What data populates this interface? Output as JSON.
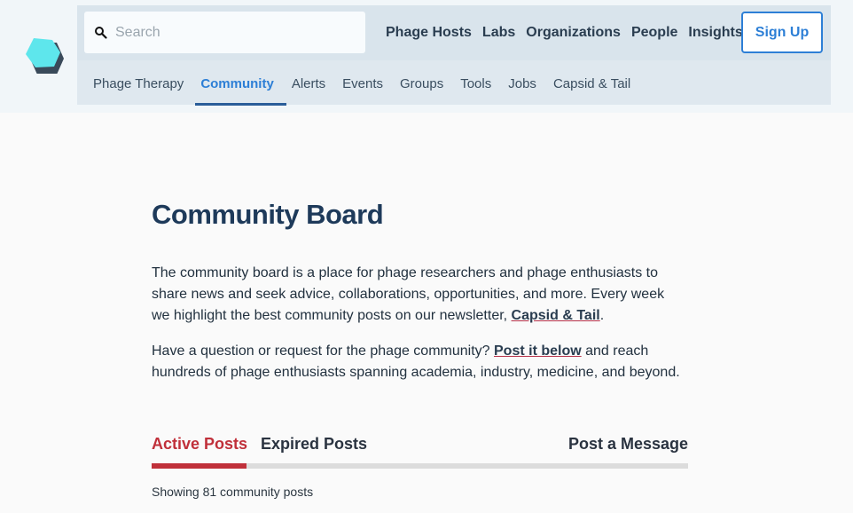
{
  "search": {
    "placeholder": "Search"
  },
  "topnav": [
    {
      "label": "Phage Hosts"
    },
    {
      "label": "Labs"
    },
    {
      "label": "Organizations"
    },
    {
      "label": "People"
    },
    {
      "label": "Insights"
    }
  ],
  "signup_label": "Sign Up",
  "subnav": [
    {
      "label": "Phage Therapy"
    },
    {
      "label": "Community"
    },
    {
      "label": "Alerts"
    },
    {
      "label": "Events"
    },
    {
      "label": "Groups"
    },
    {
      "label": "Tools"
    },
    {
      "label": "Jobs"
    },
    {
      "label": "Capsid & Tail"
    }
  ],
  "page": {
    "title": "Community Board",
    "intro_pre": "The community board is a place for phage researchers and phage enthusiasts to share news and seek advice, collaborations, opportunities, and more. Every week we highlight the best community posts on our newsletter, ",
    "intro_link": "Capsid & Tail",
    "intro_post": ".",
    "q_pre": "Have a question or request for the phage community? ",
    "q_link": "Post it below",
    "q_post": " and reach hundreds of phage enthusiasts spanning academia, industry, medicine, and beyond."
  },
  "tabs": {
    "active": "Active Posts",
    "expired": "Expired Posts",
    "post": "Post a Message"
  },
  "status": {
    "count_text": "Showing 81 community posts"
  },
  "colors": {
    "accent": "#2d7fd6",
    "brand_red": "#c0303a",
    "heading": "#1e3a5a",
    "logo": "#5ee6ec"
  },
  "icons": {
    "logo": "hexagon-logo-icon",
    "search": "search-icon"
  }
}
